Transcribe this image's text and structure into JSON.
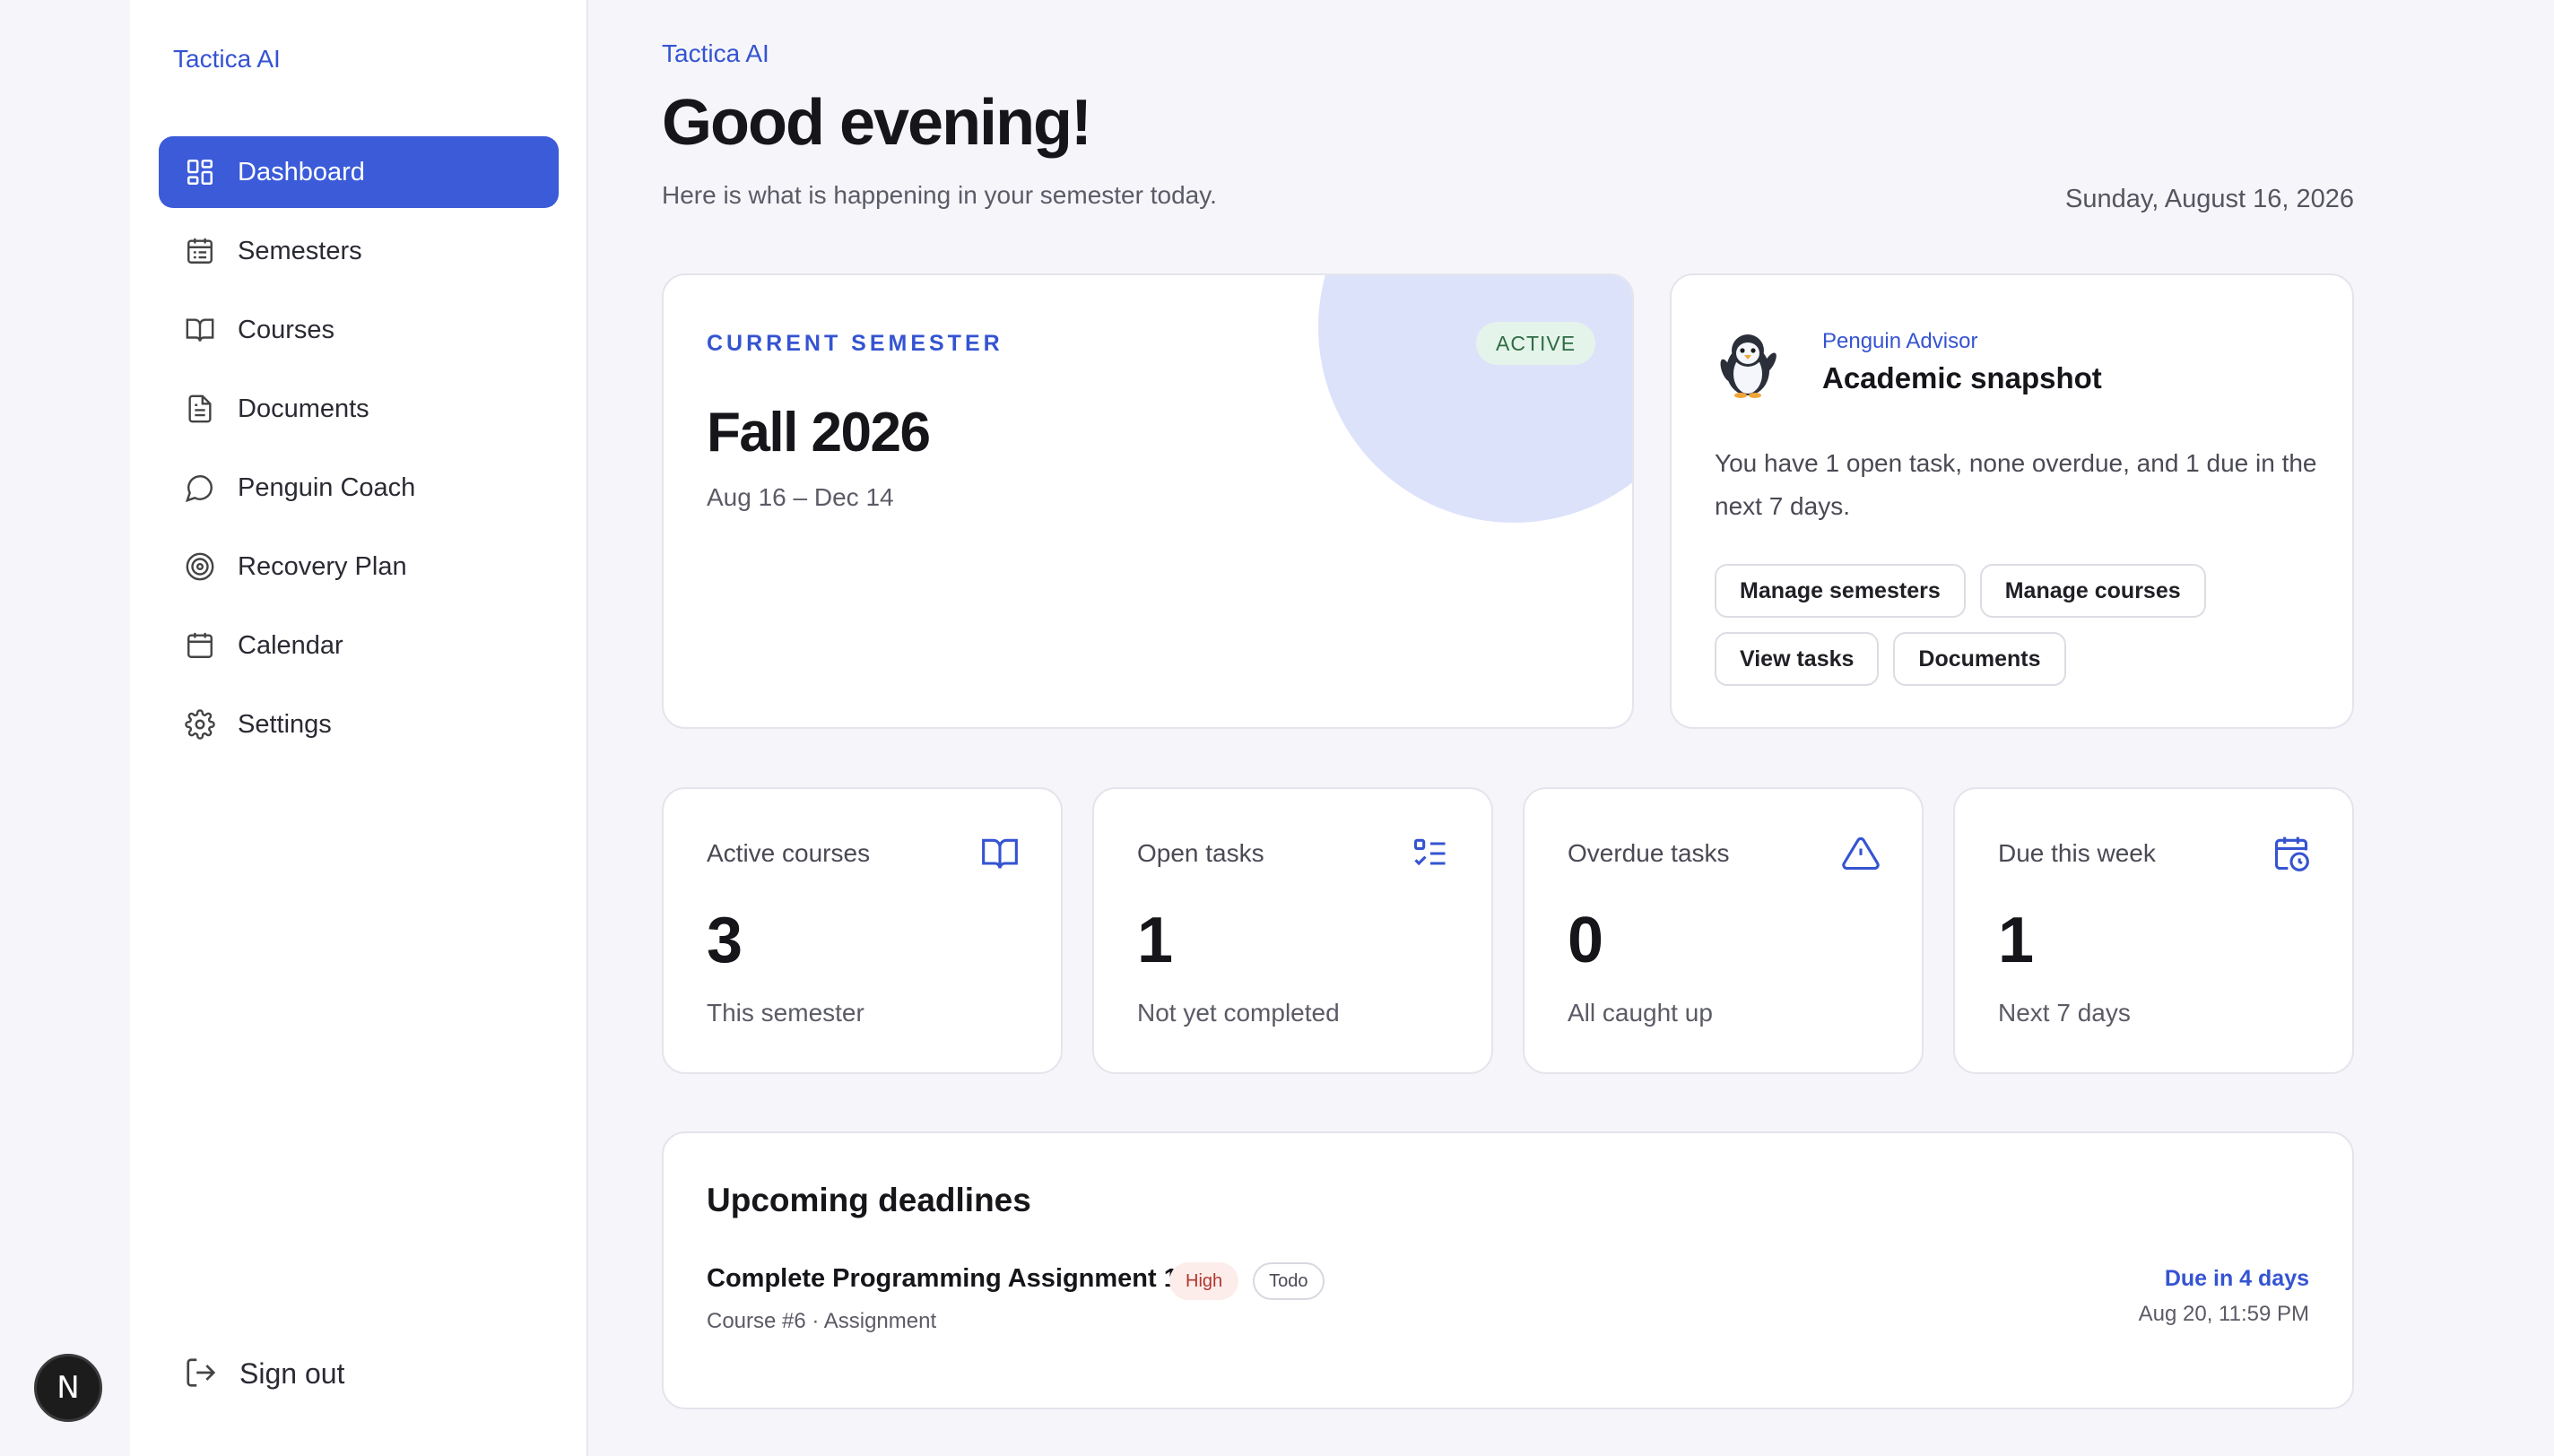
{
  "app": {
    "name": "Tactica AI"
  },
  "gutter": {
    "badge": "N"
  },
  "sidebar": {
    "brand": "Tactica AI",
    "items": [
      {
        "label": "Dashboard",
        "icon": "dashboard-icon",
        "active": true
      },
      {
        "label": "Semesters",
        "icon": "calendar-list-icon"
      },
      {
        "label": "Courses",
        "icon": "book-icon"
      },
      {
        "label": "Documents",
        "icon": "document-icon"
      },
      {
        "label": "Penguin Coach",
        "icon": "chat-bubble-icon"
      },
      {
        "label": "Recovery Plan",
        "icon": "target-icon"
      },
      {
        "label": "Calendar",
        "icon": "calendar-icon"
      },
      {
        "label": "Settings",
        "icon": "gear-icon"
      }
    ],
    "signout": "Sign out"
  },
  "header": {
    "brand": "Tactica AI",
    "greeting": "Good evening!",
    "subtitle": "Here is what is happening in your semester today.",
    "date": "Sunday, August 16, 2026"
  },
  "semester": {
    "label": "CURRENT SEMESTER",
    "status": "ACTIVE",
    "name": "Fall 2026",
    "range": "Aug 16 – Dec 14"
  },
  "advisor": {
    "kicker": "Penguin Advisor",
    "title": "Academic snapshot",
    "text": "You have 1 open task, none overdue, and 1 due in the next 7 days.",
    "actions": [
      "Manage semesters",
      "Manage courses",
      "View tasks",
      "Documents"
    ]
  },
  "stats": [
    {
      "label": "Active courses",
      "value": "3",
      "sub": "This semester",
      "icon": "book-icon"
    },
    {
      "label": "Open tasks",
      "value": "1",
      "sub": "Not yet completed",
      "icon": "checklist-icon"
    },
    {
      "label": "Overdue tasks",
      "value": "0",
      "sub": "All caught up",
      "icon": "warning-icon"
    },
    {
      "label": "Due this week",
      "value": "1",
      "sub": "Next 7 days",
      "icon": "calendar-clock-icon"
    }
  ],
  "deadlines": {
    "title": "Upcoming deadlines",
    "items": [
      {
        "name": "Complete Programming Assignment 1",
        "priority": "High",
        "status": "Todo",
        "meta": "Course #6 · Assignment",
        "due": "Due in 4 days",
        "when": "Aug 20, 11:59 PM"
      }
    ]
  },
  "colors": {
    "accent": "#3b5bd9",
    "link": "#3554d1",
    "background": "#f5f5fa",
    "active_badge_bg": "#e4f4ea",
    "high_tag_bg": "#fcecea"
  }
}
